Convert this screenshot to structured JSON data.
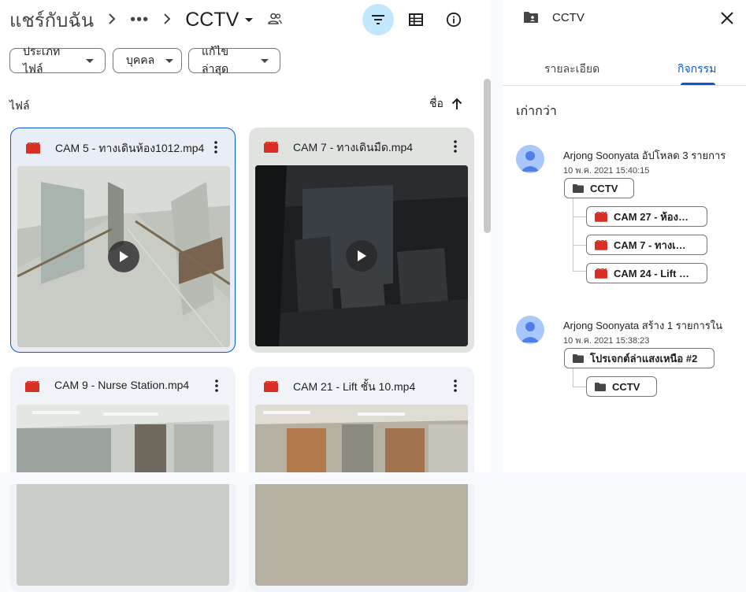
{
  "breadcrumb": {
    "root": "แชร์กับฉัน",
    "more": "•••",
    "current": "CCTV"
  },
  "filters": [
    {
      "label": "ประเภทไฟล์"
    },
    {
      "label": "บุคคล"
    },
    {
      "label": "แก้ไขล่าสุด"
    }
  ],
  "section": {
    "label": "ไฟล์"
  },
  "sort": {
    "label": "ชื่อ",
    "direction": "ascending"
  },
  "files": [
    {
      "name": "CAM 5 - ทางเดินห้อง1012.mp4",
      "selected": true
    },
    {
      "name": "CAM 7 - ทางเดินมืด.mp4",
      "selected": false
    },
    {
      "name": "CAM 9 - Nurse Station.mp4",
      "selected": false
    },
    {
      "name": "CAM 21 - Lift ชั้น 10.mp4",
      "selected": false
    }
  ],
  "details": {
    "title": "CCTV",
    "tabs": [
      {
        "label": "รายละเอียด"
      },
      {
        "label": "กิจกรรม"
      }
    ],
    "active_tab": "กิจกรรม",
    "older_label": "เก่ากว่า",
    "activities": [
      {
        "text": "Arjong Soonyata อัปโหลด 3 รายการ",
        "time": "10 พ.ค. 2021 15:40:15",
        "parent": "CCTV",
        "items": [
          "CAM 27 - ห้อง…",
          "CAM 7 - ทางเ…",
          "CAM 24 - Lift …"
        ]
      },
      {
        "text": "Arjong Soonyata สร้าง 1 รายการใน",
        "time": "10 พ.ค. 2021 15:38:23",
        "parent": "โปรเจกต์ล่าแสงเหนือ #2",
        "items": [
          "CCTV"
        ]
      }
    ]
  },
  "colors": {
    "accent": "#0b57d0",
    "selected_bg": "#c2e7ff",
    "video_icon": "#d93025"
  }
}
